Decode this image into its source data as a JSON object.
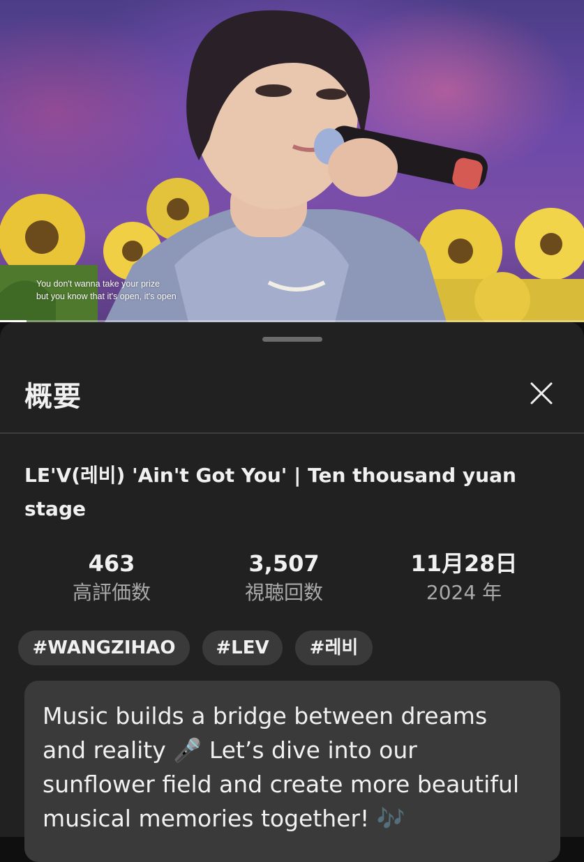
{
  "video": {
    "lyrics_line_1": "You don't wanna take your prize",
    "lyrics_line_2": "but you know that it's open, it's open",
    "progress_fraction": 0.045
  },
  "sheet": {
    "title": "概要",
    "close_icon": "close-icon"
  },
  "video_title": "LE'V(레비) 'Ain't Got You' | Ten thousand yuan stage",
  "stats": {
    "likes_value": "463",
    "likes_label": "高評価数",
    "views_value": "3,507",
    "views_label": "視聴回数",
    "date_value": "11月28日",
    "date_year": "2024 年"
  },
  "tags": [
    "#WANGZIHAO",
    "#LEV",
    "#레비"
  ],
  "description": {
    "line_1": "Music builds a bridge between dreams",
    "line_2": "and reality 🎤 Let’s dive into our",
    "line_3": "sunflower field and create more beautiful",
    "line_4": "musical memories together! 🎶"
  },
  "colors": {
    "background": "#0f0f0f",
    "sheet": "#212121",
    "chip": "#3a3a3a",
    "text_primary": "#f1f1f1",
    "text_secondary": "#aaaaaa"
  }
}
